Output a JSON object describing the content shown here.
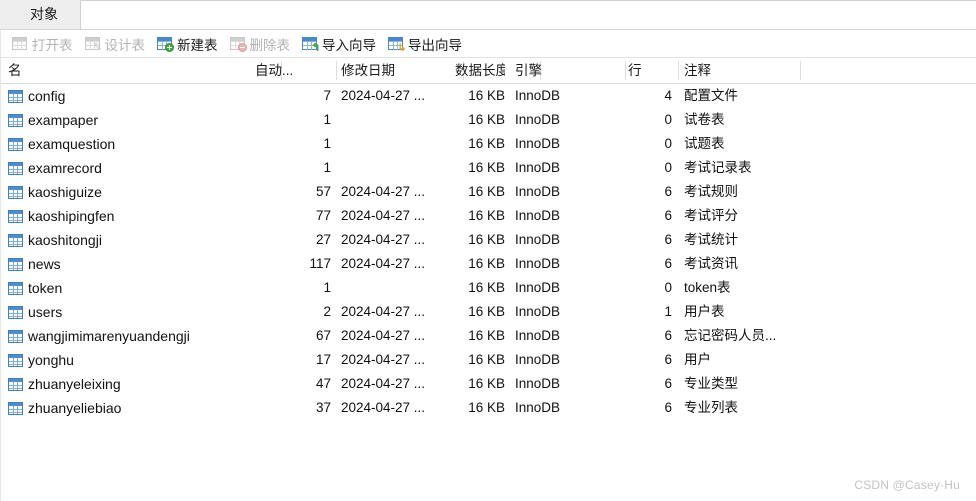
{
  "tabs": {
    "items": [
      {
        "label": "对象",
        "active": true
      }
    ]
  },
  "toolbar": {
    "buttons": [
      {
        "label": "打开表",
        "icon": "open-table-icon",
        "enabled": false,
        "badge": "none"
      },
      {
        "label": "设计表",
        "icon": "design-table-icon",
        "enabled": false,
        "badge": "pencil"
      },
      {
        "label": "新建表",
        "icon": "new-table-icon",
        "enabled": true,
        "badge": "plus"
      },
      {
        "label": "删除表",
        "icon": "delete-table-icon",
        "enabled": false,
        "badge": "minus"
      },
      {
        "label": "导入向导",
        "icon": "import-wizard-icon",
        "enabled": true,
        "badge": "arrowgreen"
      },
      {
        "label": "导出向导",
        "icon": "export-wizard-icon",
        "enabled": true,
        "badge": "arroworange"
      }
    ]
  },
  "grid": {
    "columns": [
      {
        "key": "name",
        "label": "名",
        "align": "left"
      },
      {
        "key": "auto",
        "label": "自动...",
        "align": "right"
      },
      {
        "key": "modified",
        "label": "修改日期",
        "align": "left"
      },
      {
        "key": "length",
        "label": "数据长度",
        "align": "right"
      },
      {
        "key": "engine",
        "label": "引擎",
        "align": "left"
      },
      {
        "key": "rows",
        "label": "行",
        "align": "right"
      },
      {
        "key": "comment",
        "label": "注释",
        "align": "left"
      }
    ],
    "rows": [
      {
        "name": "config",
        "auto": "7",
        "modified": "2024-04-27 ...",
        "length": "16 KB",
        "engine": "InnoDB",
        "rows": "4",
        "comment": "配置文件"
      },
      {
        "name": "exampaper",
        "auto": "1",
        "modified": "",
        "length": "16 KB",
        "engine": "InnoDB",
        "rows": "0",
        "comment": "试卷表"
      },
      {
        "name": "examquestion",
        "auto": "1",
        "modified": "",
        "length": "16 KB",
        "engine": "InnoDB",
        "rows": "0",
        "comment": "试题表"
      },
      {
        "name": "examrecord",
        "auto": "1",
        "modified": "",
        "length": "16 KB",
        "engine": "InnoDB",
        "rows": "0",
        "comment": "考试记录表"
      },
      {
        "name": "kaoshiguize",
        "auto": "57",
        "modified": "2024-04-27 ...",
        "length": "16 KB",
        "engine": "InnoDB",
        "rows": "6",
        "comment": "考试规则"
      },
      {
        "name": "kaoshipingfen",
        "auto": "77",
        "modified": "2024-04-27 ...",
        "length": "16 KB",
        "engine": "InnoDB",
        "rows": "6",
        "comment": "考试评分"
      },
      {
        "name": "kaoshitongji",
        "auto": "27",
        "modified": "2024-04-27 ...",
        "length": "16 KB",
        "engine": "InnoDB",
        "rows": "6",
        "comment": "考试统计"
      },
      {
        "name": "news",
        "auto": "117",
        "modified": "2024-04-27 ...",
        "length": "16 KB",
        "engine": "InnoDB",
        "rows": "6",
        "comment": "考试资讯"
      },
      {
        "name": "token",
        "auto": "1",
        "modified": "",
        "length": "16 KB",
        "engine": "InnoDB",
        "rows": "0",
        "comment": "token表"
      },
      {
        "name": "users",
        "auto": "2",
        "modified": "2024-04-27 ...",
        "length": "16 KB",
        "engine": "InnoDB",
        "rows": "1",
        "comment": "用户表"
      },
      {
        "name": "wangjimimarenyuandengji",
        "auto": "67",
        "modified": "2024-04-27 ...",
        "length": "16 KB",
        "engine": "InnoDB",
        "rows": "6",
        "comment": "忘记密码人员..."
      },
      {
        "name": "yonghu",
        "auto": "17",
        "modified": "2024-04-27 ...",
        "length": "16 KB",
        "engine": "InnoDB",
        "rows": "6",
        "comment": "用户"
      },
      {
        "name": "zhuanyeleixing",
        "auto": "47",
        "modified": "2024-04-27 ...",
        "length": "16 KB",
        "engine": "InnoDB",
        "rows": "6",
        "comment": "专业类型"
      },
      {
        "name": "zhuanyeliebiao",
        "auto": "37",
        "modified": "2024-04-27 ...",
        "length": "16 KB",
        "engine": "InnoDB",
        "rows": "6",
        "comment": "专业列表"
      }
    ]
  },
  "watermark": {
    "text": "CSDN @Casey·Hu"
  },
  "colors": {
    "accent": "#4f8fcc",
    "tabbar": "#eeeeee",
    "disabled_text": "#b3b3b3",
    "badge_add": "#3faa3f",
    "badge_remove": "#e9b4b4",
    "badge_import": "#2aa32a",
    "badge_export": "#efa314",
    "watermark": "#c3c3c3"
  }
}
